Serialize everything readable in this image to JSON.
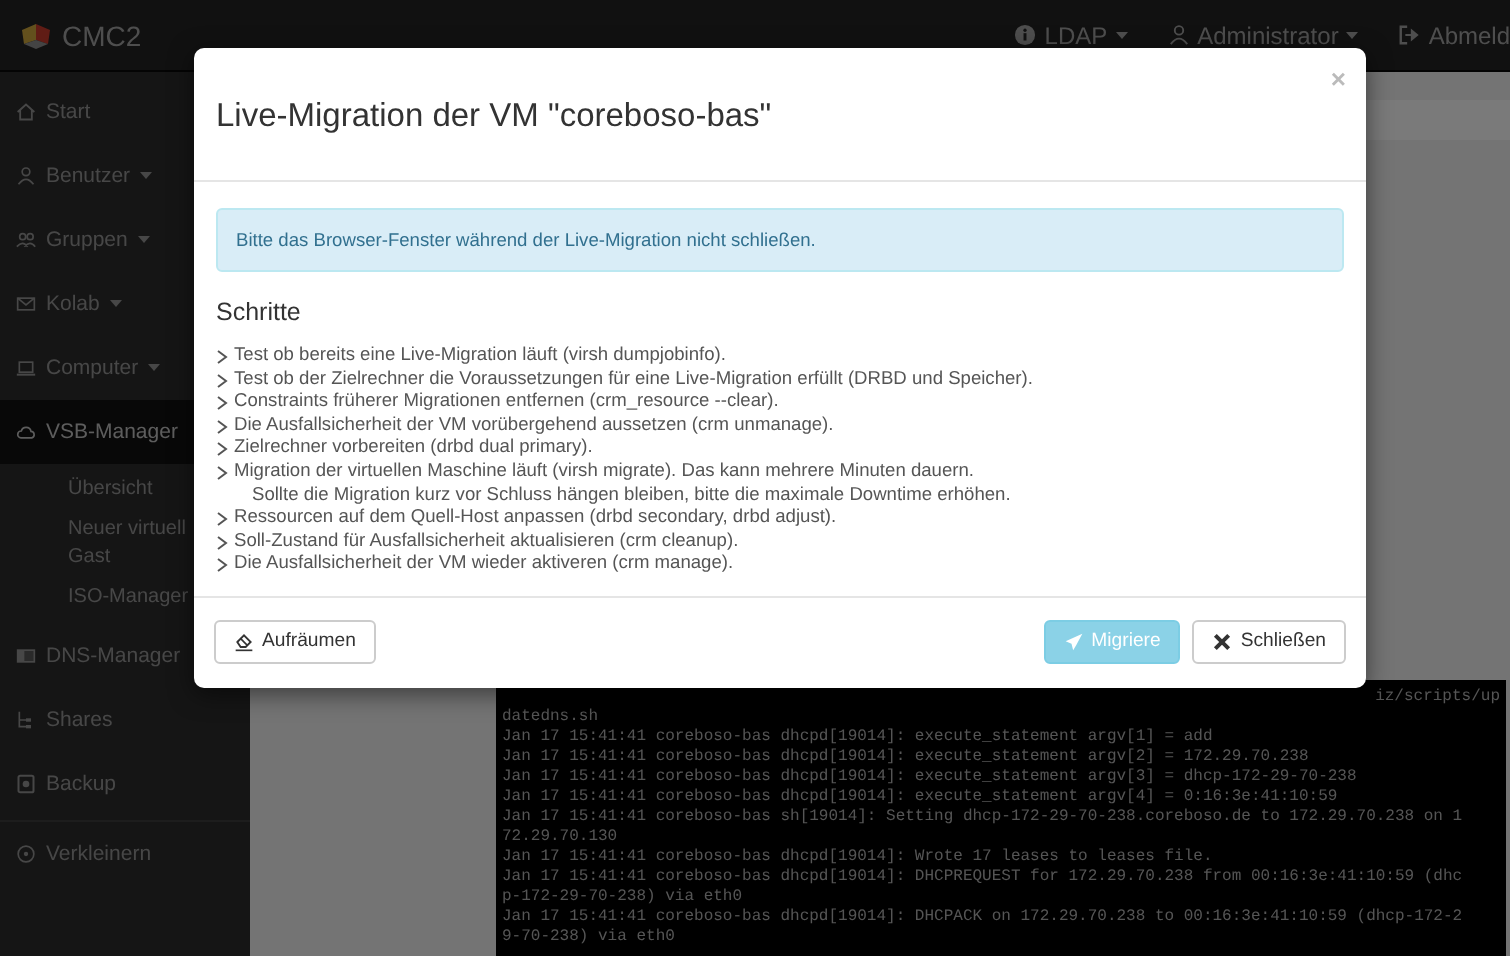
{
  "navbar": {
    "brand": "CMC2",
    "items": [
      {
        "label": "LDAP",
        "caret": true
      },
      {
        "label": "Administrator",
        "caret": true
      },
      {
        "label": "Abmeld",
        "caret": false
      }
    ]
  },
  "sidebar": {
    "items": [
      {
        "label": "Start",
        "kind": "main",
        "caret": false,
        "selected": false
      },
      {
        "label": "Benutzer",
        "kind": "main",
        "caret": true,
        "selected": false
      },
      {
        "label": "Gruppen",
        "kind": "main",
        "caret": true,
        "selected": false
      },
      {
        "label": "Kolab",
        "kind": "main",
        "caret": true,
        "selected": false
      },
      {
        "label": "Computer",
        "kind": "main",
        "caret": true,
        "selected": false
      },
      {
        "label": "VSB-Manager",
        "kind": "main",
        "caret": false,
        "selected": true
      },
      {
        "label": "Übersicht",
        "kind": "sub",
        "selected": false
      },
      {
        "label": "Neuer virtuell Gast",
        "kind": "sub",
        "selected": false
      },
      {
        "label": "ISO-Manager",
        "kind": "sub",
        "selected": false
      },
      {
        "label": "DNS-Manager",
        "kind": "main",
        "caret": false,
        "selected": false
      },
      {
        "label": "Shares",
        "kind": "main",
        "caret": false,
        "selected": false
      },
      {
        "label": "Backup",
        "kind": "main",
        "caret": false,
        "selected": false
      },
      {
        "label": "Verkleinern",
        "kind": "footer",
        "caret": false,
        "selected": false
      }
    ]
  },
  "console": {
    "lines": [
      "iz/scripts/up",
      "datedns.sh",
      "Jan 17 15:41:41 coreboso-bas dhcpd[19014]: execute_statement argv[1] = add",
      "Jan 17 15:41:41 coreboso-bas dhcpd[19014]: execute_statement argv[2] = 172.29.70.238",
      "Jan 17 15:41:41 coreboso-bas dhcpd[19014]: execute_statement argv[3] = dhcp-172-29-70-238",
      "Jan 17 15:41:41 coreboso-bas dhcpd[19014]: execute_statement argv[4] = 0:16:3e:41:10:59",
      "Jan 17 15:41:41 coreboso-bas sh[19014]: Setting dhcp-172-29-70-238.coreboso.de to 172.29.70.238 on 1",
      "72.29.70.130",
      "Jan 17 15:41:41 coreboso-bas dhcpd[19014]: Wrote 17 leases to leases file.",
      "Jan 17 15:41:41 coreboso-bas dhcpd[19014]: DHCPREQUEST for 172.29.70.238 from 00:16:3e:41:10:59 (dhc",
      "p-172-29-70-238) via eth0",
      "Jan 17 15:41:41 coreboso-bas dhcpd[19014]: DHCPACK on 172.29.70.238 to 00:16:3e:41:10:59 (dhcp-172-2",
      "9-70-238) via eth0"
    ]
  },
  "dialog": {
    "title": "Live-Migration der VM \"coreboso-bas\"",
    "close": "×",
    "alert": "Bitte das Browser-Fenster während der Live-Migration nicht schließen.",
    "heading": "Schritte",
    "steps": [
      {
        "text": "Test ob bereits eine Live-Migration läuft (virsh dumpjobinfo)."
      },
      {
        "text": "Test ob der Zielrechner die Voraussetzungen für eine Live-Migration erfüllt (DRBD und Speicher)."
      },
      {
        "text": "Constraints früherer Migrationen entfernen (crm_resource --clear)."
      },
      {
        "text": "Die Ausfallsicherheit der VM vorübergehend aussetzen (crm unmanage)."
      },
      {
        "text": "Zielrechner vorbereiten (drbd dual primary)."
      },
      {
        "text": "Migration der virtuellen Maschine läuft (virsh migrate). Das kann mehrere Minuten dauern.",
        "note": "Sollte die Migration kurz vor Schluss hängen bleiben, bitte die maximale Downtime erhöhen."
      },
      {
        "text": "Ressourcen auf dem Quell-Host anpassen (drbd secondary, drbd adjust)."
      },
      {
        "text": "Soll-Zustand für Ausfallsicherheit aktualisieren (crm cleanup)."
      },
      {
        "text": "Die Ausfallsicherheit der VM wieder aktiveren (crm manage)."
      }
    ],
    "buttons": [
      {
        "label": "Aufräumen",
        "kind": "default"
      },
      {
        "label": "Migriere",
        "kind": "primary"
      },
      {
        "label": "Schließen",
        "kind": "default"
      }
    ]
  }
}
